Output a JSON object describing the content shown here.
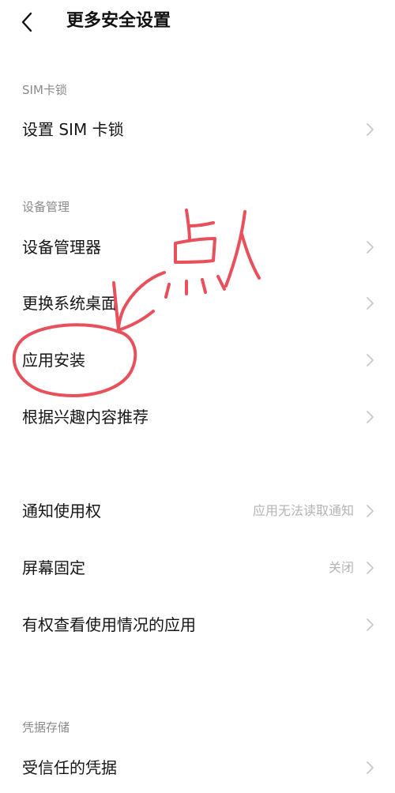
{
  "header": {
    "title": "更多安全设置",
    "back_icon": "chevron-left-icon"
  },
  "sections": [
    {
      "label": "SIM卡锁",
      "items": [
        {
          "label": "设置 SIM 卡锁",
          "value": ""
        }
      ]
    },
    {
      "label": "设备管理",
      "items": [
        {
          "label": "设备管理器",
          "value": ""
        },
        {
          "label": "更换系统桌面",
          "value": ""
        },
        {
          "label": "应用安装",
          "value": ""
        },
        {
          "label": "根据兴趣内容推荐",
          "value": ""
        }
      ]
    },
    {
      "label": "",
      "items": [
        {
          "label": "通知使用权",
          "value": "应用无法读取通知"
        },
        {
          "label": "屏幕固定",
          "value": "关闭"
        },
        {
          "label": "有权查看使用情况的应用",
          "value": ""
        }
      ]
    },
    {
      "label": "凭据存储",
      "items": [
        {
          "label": "受信任的凭据",
          "value": ""
        }
      ]
    }
  ],
  "annotation": {
    "color": "#e8505b",
    "handwritten_text": "点入"
  },
  "colors": {
    "section_label": "#8a8a8a",
    "value_text": "#b4b4b4",
    "chevron": "#c8c8c8",
    "annotation": "#e8505b"
  }
}
